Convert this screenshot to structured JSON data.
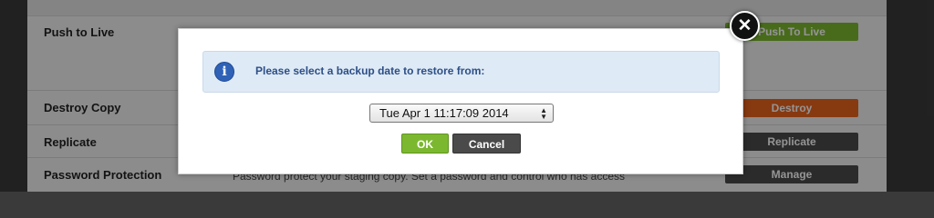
{
  "settings": {
    "rows": [
      {
        "label": "Push to Live",
        "button": "Push To Live",
        "button_color": "#7cb82f"
      },
      {
        "label": "Destroy Copy",
        "button": "Destroy",
        "button_color": "#e8621c"
      },
      {
        "label": "Replicate",
        "button": "Replicate",
        "button_color": "#4b4b4b"
      },
      {
        "label": "Password Protection",
        "button": "Manage",
        "button_color": "#4b4b4b",
        "description": "Password protect your staging copy. Set a password and control who has access"
      }
    ]
  },
  "dialog": {
    "message": "Please select a backup date to restore from:",
    "info_icon": "info-icon",
    "selected_backup": "Tue Apr 1 11:17:09 2014",
    "ok_label": "OK",
    "cancel_label": "Cancel",
    "close_glyph": "✕",
    "colors": {
      "info_bg": "#deeaf6",
      "info_text": "#2d4f86",
      "ok": "#7cb82f",
      "cancel": "#4a4a4a"
    }
  }
}
